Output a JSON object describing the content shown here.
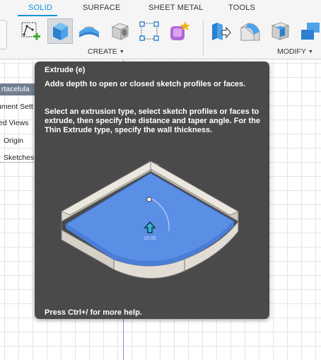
{
  "toolbar": {
    "tabs": [
      {
        "label": "SOLID",
        "active": true
      },
      {
        "label": "SURFACE",
        "active": false
      },
      {
        "label": "SHEET METAL",
        "active": false
      },
      {
        "label": "TOOLS",
        "active": false
      }
    ],
    "groups": {
      "create": {
        "label": "CREATE",
        "tools": [
          "create-sketch-icon",
          "extrude-icon",
          "revolve-icon",
          "hole-icon",
          "pattern-icon",
          "create-form-icon"
        ]
      },
      "modify": {
        "label": "MODIFY",
        "tools": [
          "press-pull-icon",
          "fillet-icon",
          "shell-icon",
          "combine-icon"
        ]
      }
    },
    "accent_color": "#0696d7"
  },
  "browser": {
    "title": "rtacelula",
    "items": [
      "ument Sett",
      "ed Views",
      "Origin",
      "Sketches"
    ]
  },
  "tooltip": {
    "title": "Extrude (e)",
    "summary": "Adds depth to open or closed sketch profiles or faces.",
    "details": "Select an extrusion type, select sketch profiles or faces to extrude, then specify the distance and taper angle. For the Thin Extrude type, specify the wall thickness.",
    "help": "Press Ctrl+/ for more help.",
    "illustration": {
      "dimension_label": "10.00",
      "face_color": "#5b8fe6",
      "wall_color": "#e2ddd4"
    }
  }
}
